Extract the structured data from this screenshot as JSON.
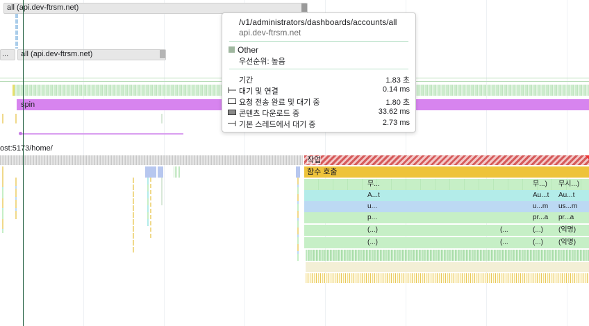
{
  "network": {
    "top_request_label": "all (api.dev-ftrsm.net)",
    "second_request_label": "all (api.dev-ftrsm.net)",
    "left_partial_label": "..."
  },
  "tracks": {
    "spin_label": "spin",
    "page_url": "ost:5173/home/",
    "task_label": "작업",
    "function_call_label": "함수 호출"
  },
  "flame": {
    "rows": [
      {
        "cells": [
          "무...",
          "무...)",
          "무시...)"
        ]
      },
      {
        "cells": [
          "A...t",
          "Au...t",
          "Au...t"
        ]
      },
      {
        "cells": [
          "u...",
          "u...m",
          "us...m"
        ]
      },
      {
        "cells": [
          "p...",
          "pr...a",
          "pr...a"
        ]
      },
      {
        "cells": [
          "(...)",
          "(...",
          "(...)",
          "(익명)"
        ]
      },
      {
        "cells": [
          "(...)",
          "(...",
          "(...)",
          "(익명)"
        ]
      }
    ]
  },
  "tooltip": {
    "url": "/v1/administrators/dashboards/accounts/all",
    "host": "api.dev-ftrsm.net",
    "category": "Other",
    "priority": "우선순위: 높음",
    "rows": [
      {
        "icon": "none",
        "label": "기간",
        "value": "1.83 초"
      },
      {
        "icon": "queue-whisker-icon",
        "label": "대기 및 연결",
        "value": "0.14 ms"
      },
      {
        "icon": "request-box-icon",
        "label": "요청 전송 완료 및 대기 중",
        "value": "1.80 초"
      },
      {
        "icon": "download-box-icon",
        "label": "콘텐츠 다운로드 중",
        "value": "33.62 ms"
      },
      {
        "icon": "main-thread-whisker-icon",
        "label": "기본 스레드에서 대기 중",
        "value": "2.73 ms"
      }
    ]
  },
  "colors": {
    "spin": "#d784ef",
    "function_call": "#eec33a",
    "task_hatch": "#d65b5b",
    "flame_cyan": "#b3ece9",
    "flame_blue": "#bcd9f3",
    "flame_green": "#c6efc6",
    "cursor": "#1a5b3a"
  }
}
